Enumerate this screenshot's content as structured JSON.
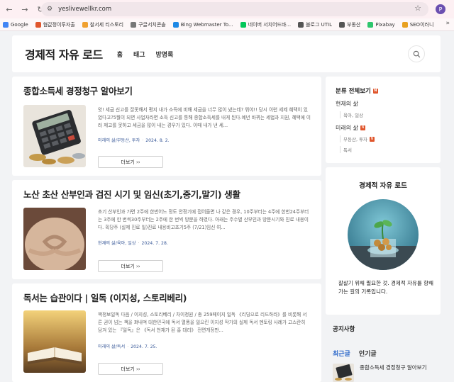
{
  "browser": {
    "url": "yeslivewellkr.com",
    "profile_initial": "P"
  },
  "bookmarks": [
    {
      "label": "Google",
      "color": "#4285f4"
    },
    {
      "label": "협값정이투자출",
      "color": "#e0562c"
    },
    {
      "label": "찰서세 티스토리",
      "color": "#f0a030"
    },
    {
      "label": "구글서치콘솔",
      "color": "#777777"
    },
    {
      "label": "Bing Webmaster To...",
      "color": "#1e88e5"
    },
    {
      "label": "네이버 서치어드바...",
      "color": "#03c75a"
    },
    {
      "label": "블로그 UTIL",
      "color": "#555555"
    },
    {
      "label": "부동산",
      "color": "#555555"
    },
    {
      "label": "Pixabay",
      "color": "#2ec66d"
    },
    {
      "label": "SEO이러니",
      "color": "#e8a020"
    }
  ],
  "header": {
    "title": "경제적 자유 로드",
    "menu": [
      "홈",
      "태그",
      "방명록"
    ]
  },
  "posts": [
    {
      "title": "종합소득세 경정청구 알아보기",
      "excerpt": "앗! 세금 신고를 잘못해서 평지 내가 소득에 비해 세금을 너무 많이 냈는데? 뭐야!! 당시 이런 세제 혜택이 있었다고?5월이 되면 사업자라면 소득 신고를 통해 종합소득세를 내게 된다.예년 바뀌는 세법과 지원, 혜택에 이러 제고를 못하고 세금을 많이 내는 경우가 있다. 이때 내가 낸 세...",
      "category": "미래의 삶/부동산, 투자",
      "date": "2024. 8. 2.",
      "more": "더보기 ››"
    },
    {
      "title": "노산 초산 산부인과 검진 시기 및 임신(초기,중기,말기) 생활",
      "excerpt": "초기 산부인과 가면 2주에 한번어느 정도 안정기에 접어들면 나 같은 경우, 10주부터는 4주에 한번24주부터는 3주에 한 번씩30주부터는 2주에 한 번씩 방문을 하였다. 아래는 주수별 산부인과 방문시기와 진료 내용이다. 획당주 (실제 진료 일)진료 내용비고초기5주 (7/21)임신 여...",
      "category": "현재의 삶/육아, 일상",
      "date": "2024. 7. 28.",
      "more": "더보기 ››"
    },
    {
      "title": "독서는 습관이다 | 일독 (이지성, 스토리베리)",
      "excerpt": "책정보일독 다음 / 이지성, 스토리베리 / 차이정원 / 총 259페이지 일독 《리딩으로 리드하라》를 비롯해 서른 권이 넘는 책을 펴내며 대한민국에 독서 열풍을 일으킨 이지성 작가의 실제 독서 멘토링 사례가 고스란히 담겨 있는 『일독』은 《독서 천재가 된 홍 대리》 전면개정판...",
      "category": "미래의 삶/독서",
      "date": "2024. 7. 25.",
      "more": "더보기 ››"
    }
  ],
  "sidebar": {
    "category_head": "분류 전체보기",
    "categories": [
      {
        "label": "현재의 삶",
        "badge": false,
        "subs": [
          {
            "label": "육아, 일상",
            "badge": false
          }
        ]
      },
      {
        "label": "미래의 삶",
        "badge": true,
        "subs": [
          {
            "label": "부동산, 투자",
            "badge": true
          },
          {
            "label": "독서",
            "badge": false
          }
        ]
      }
    ],
    "profile_title": "경제적 자유 로드",
    "profile_desc": "잘살기 위해 필요한 것. 경제적 자유를 향해 가는 길의 기록입니다.",
    "notice": "공지사항",
    "tabs": [
      "최근글",
      "인기글"
    ],
    "recent_title": "종합소득세 경정청구 알아보기"
  },
  "colors": {
    "accent": "#2a66c9",
    "badge": "#e0562c",
    "meta": "#3a5a99"
  }
}
